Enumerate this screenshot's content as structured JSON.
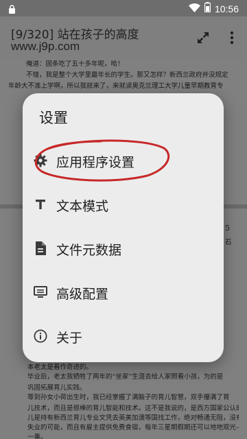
{
  "statusbar": {
    "time": "10:56",
    "icons": [
      "lock-icon",
      "wifi-icon",
      "battery-icon"
    ]
  },
  "appbar": {
    "title": "[9/320] 站在孩子的高度",
    "subtitle": "www.j9p.com",
    "actions": [
      "fullscreen-icon",
      "more-vert-icon"
    ]
  },
  "document": {
    "page1_lines": [
      "俺道：固条吃了五十多年呢，哈！",
      "不错，我是整个大学里最年长的学生。那又怎样？新西兰政府并没规定",
      "年龄大不准上学啊，所以我就来了，来就读奥克兰理工大学儿童早期教育专"
    ],
    "page2_lines": [
      "本老太是看作奇迹的。",
      "毕业后，老太我牺牲了两年的“坐家”生涯去给人家照看小孩，为的是",
      "巩固拓展育儿实践。",
      "等到孙女小荷出生时，我已经掌握了满脑子的育儿智慧，双手攥满了育",
      "儿技术，而且是很棒的育儿智能和技术。这不是我说的，是西方国家公认的，",
      "儿是持有新西兰育儿专业文凭去英美加澳等国找工作，绝对畅通无阻，没有",
      "失业的可能，而且有雇主提供免费食宿，每年三星期假期还可以地地观光—",
      "一番。"
    ],
    "edge_marks": [
      "5",
      "石"
    ]
  },
  "dialog": {
    "title": "设置",
    "items": [
      {
        "label": "应用程序设置",
        "icon": "gear-icon"
      },
      {
        "label": "文本模式",
        "icon": "text-icon"
      },
      {
        "label": "文件元数据",
        "icon": "document-icon"
      },
      {
        "label": "高级配置",
        "icon": "monitor-settings-icon"
      },
      {
        "label": "关于",
        "icon": "info-icon"
      }
    ]
  },
  "colors": {
    "dialog_bg": "#ececec",
    "annotation": "#c62828",
    "scrim": "#7f7f7f"
  }
}
